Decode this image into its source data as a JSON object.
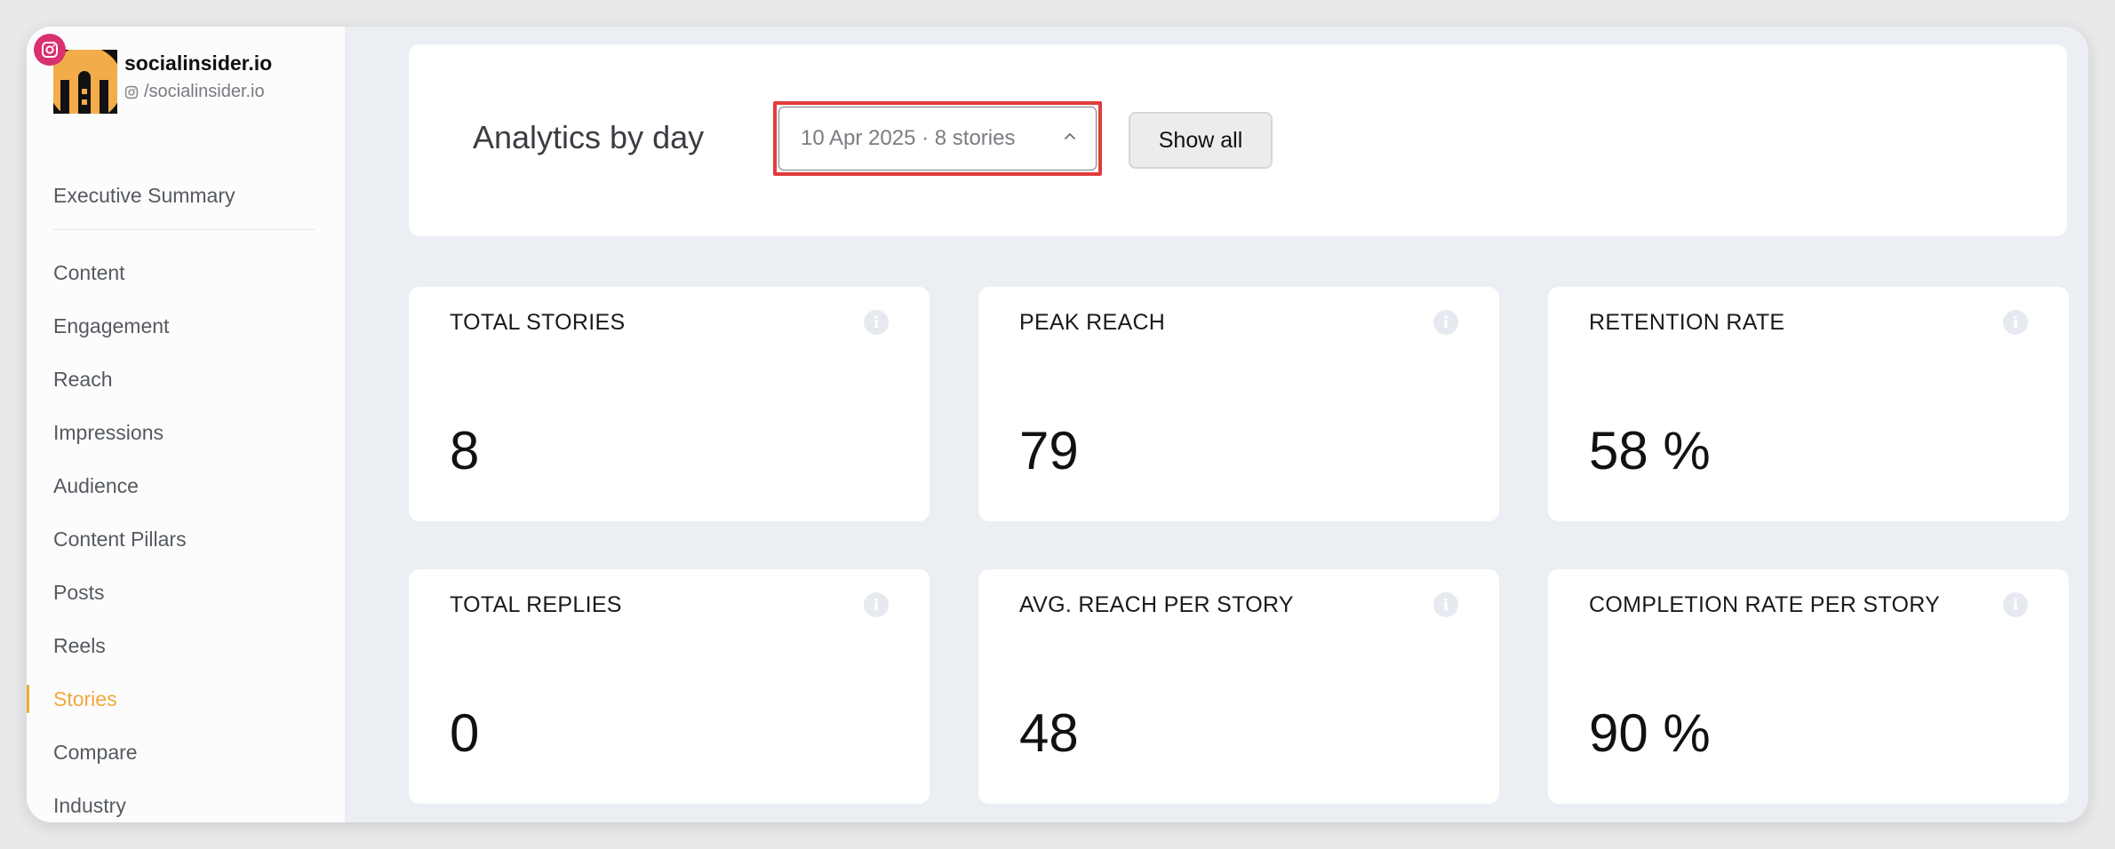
{
  "profile": {
    "name": "socialinsider.io",
    "handle": "/socialinsider.io"
  },
  "sidebar": {
    "summary": "Executive Summary",
    "items": [
      {
        "label": "Content"
      },
      {
        "label": "Engagement"
      },
      {
        "label": "Reach"
      },
      {
        "label": "Impressions"
      },
      {
        "label": "Audience"
      },
      {
        "label": "Content Pillars"
      },
      {
        "label": "Posts"
      },
      {
        "label": "Reels"
      },
      {
        "label": "Stories"
      },
      {
        "label": "Compare"
      },
      {
        "label": "Industry"
      }
    ],
    "active": "Stories"
  },
  "header": {
    "title": "Analytics by day",
    "date_select": "10 Apr 2025 · 8 stories",
    "show_all": "Show all"
  },
  "metrics": [
    {
      "label": "TOTAL STORIES",
      "value": "8"
    },
    {
      "label": "PEAK REACH",
      "value": "79"
    },
    {
      "label": "RETENTION RATE",
      "value": "58 %"
    },
    {
      "label": "TOTAL REPLIES",
      "value": "0"
    },
    {
      "label": "AVG. REACH PER STORY",
      "value": "48"
    },
    {
      "label": "COMPLETION RATE PER STORY",
      "value": "90 %"
    }
  ],
  "colors": {
    "accent": "#efa83b",
    "highlight": "#e03c3c",
    "instagram": "#d9306f"
  }
}
